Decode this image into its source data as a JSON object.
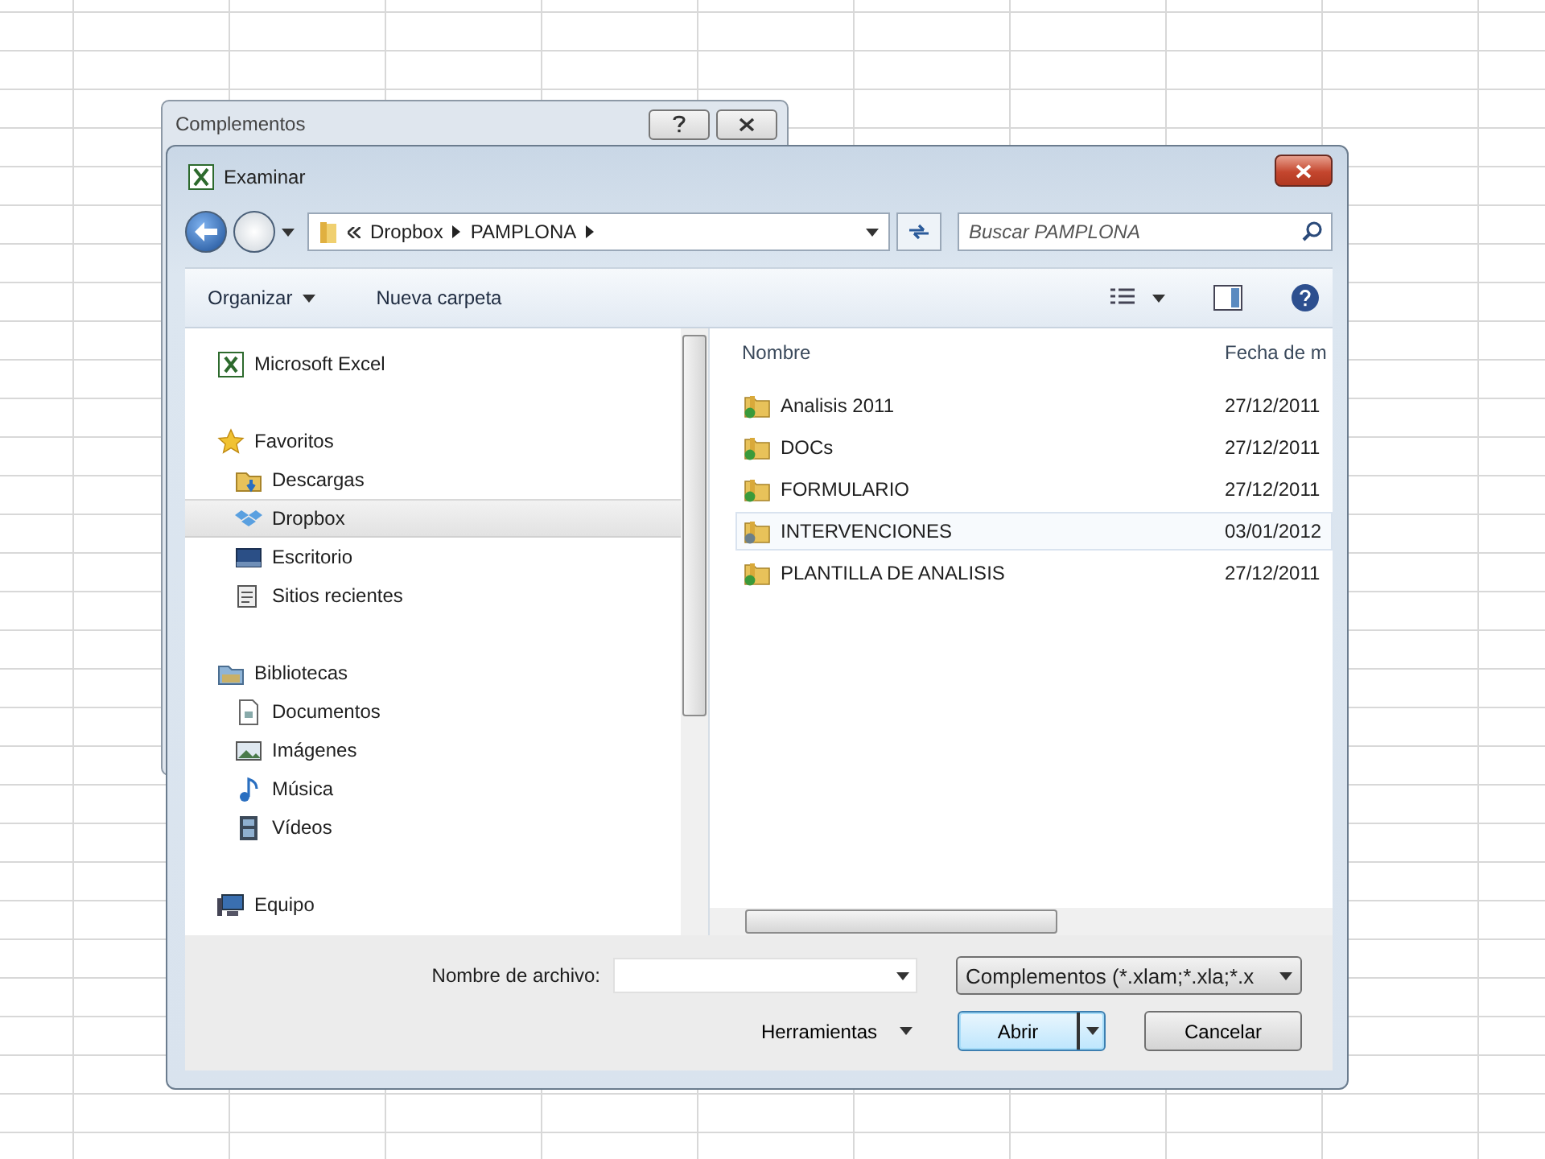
{
  "background_dialog": {
    "title": "Complementos"
  },
  "dialog": {
    "title": "Examinar",
    "address": {
      "path": [
        "Dropbox",
        "PAMPLONA"
      ]
    },
    "search": {
      "placeholder": "Buscar PAMPLONA"
    },
    "toolbar": {
      "organize": "Organizar",
      "new_folder": "Nueva carpeta"
    },
    "navigation": [
      {
        "label": "Microsoft Excel",
        "selected": false
      },
      {
        "label": "Favoritos",
        "selected": false,
        "children": [
          {
            "label": "Descargas",
            "selected": false
          },
          {
            "label": "Dropbox",
            "selected": true
          },
          {
            "label": "Escritorio",
            "selected": false
          },
          {
            "label": "Sitios recientes",
            "selected": false
          }
        ]
      },
      {
        "label": "Bibliotecas",
        "selected": false,
        "children": [
          {
            "label": "Documentos",
            "selected": false
          },
          {
            "label": "Imágenes",
            "selected": false
          },
          {
            "label": "Música",
            "selected": false
          },
          {
            "label": "Vídeos",
            "selected": false
          }
        ]
      },
      {
        "label": "Equipo",
        "selected": false
      }
    ],
    "columns": [
      "Nombre",
      "Fecha de m"
    ],
    "files": [
      {
        "name": "Analisis 2011",
        "date": "27/12/2011",
        "selected": false
      },
      {
        "name": "DOCs",
        "date": "27/12/2011",
        "selected": false
      },
      {
        "name": "FORMULARIO",
        "date": "27/12/2011",
        "selected": false
      },
      {
        "name": "INTERVENCIONES",
        "date": "03/01/2012",
        "selected": true
      },
      {
        "name": "PLANTILLA DE ANALISIS",
        "date": "27/12/2011",
        "selected": false
      }
    ],
    "file_name": {
      "label": "Nombre de archivo:"
    },
    "file_type": {
      "value": "Complementos (*.xlam;*.xla;*.x"
    },
    "tools": "Herramientas",
    "open": "Abrir",
    "cancel": "Cancelar"
  }
}
